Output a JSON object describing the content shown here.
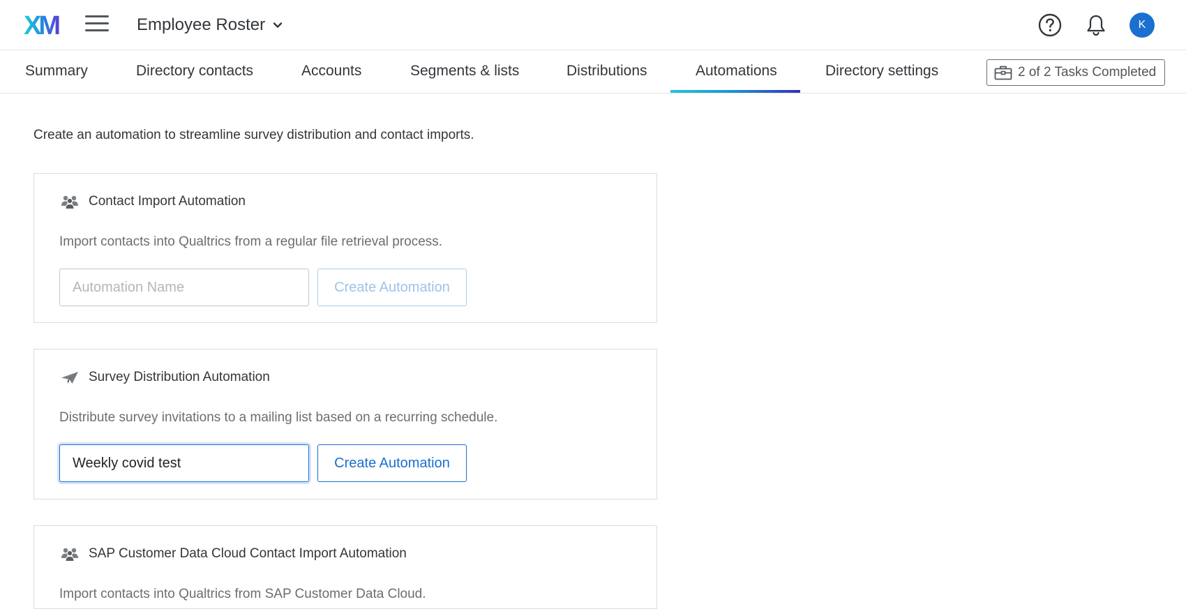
{
  "header": {
    "logo_text": "XM",
    "project_title": "Employee Roster",
    "avatar_initial": "K"
  },
  "tabs": [
    {
      "label": "Summary"
    },
    {
      "label": "Directory contacts"
    },
    {
      "label": "Accounts"
    },
    {
      "label": "Segments & lists"
    },
    {
      "label": "Distributions"
    },
    {
      "label": "Automations",
      "active": true
    },
    {
      "label": "Directory settings"
    }
  ],
  "tasks": {
    "label": "2 of 2 Tasks Completed"
  },
  "main": {
    "intro": "Create an automation to streamline survey distribution and contact imports.",
    "cards": [
      {
        "icon": "people-icon",
        "title": "Contact Import Automation",
        "description": "Import contacts into Qualtrics from a regular file retrieval process.",
        "input_placeholder": "Automation Name",
        "input_value": "",
        "button_label": "Create Automation",
        "button_enabled": false
      },
      {
        "icon": "paper-plane-icon",
        "title": "Survey Distribution Automation",
        "description": "Distribute survey invitations to a mailing list based on a recurring schedule.",
        "input_placeholder": "Automation Name",
        "input_value": "Weekly covid test",
        "button_label": "Create Automation",
        "button_enabled": true
      },
      {
        "icon": "people-icon",
        "title": "SAP Customer Data Cloud Contact Import Automation",
        "description": "Import contacts into Qualtrics from SAP Customer Data Cloud."
      }
    ]
  },
  "colors": {
    "accent_blue": "#1a6fcf",
    "text_primary": "#32363a",
    "text_secondary": "#6a6e72",
    "tab_underline_start": "#21c5d8",
    "tab_underline_end": "#3a2dbb"
  }
}
